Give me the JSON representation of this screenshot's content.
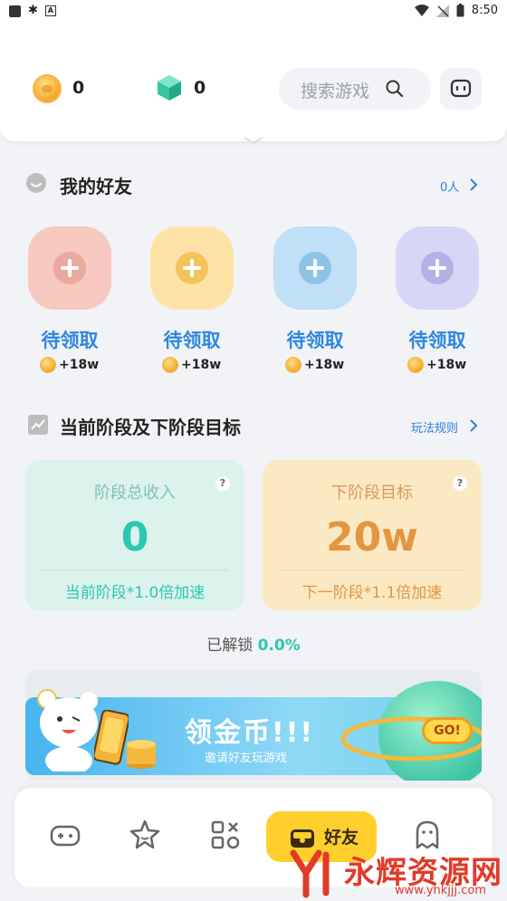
{
  "status_bar": {
    "time": "8:50"
  },
  "header": {
    "coins": "0",
    "gems": "0",
    "search_placeholder": "搜索游戏"
  },
  "friends": {
    "title": "我的好友",
    "count_link": "0人",
    "slots": [
      {
        "label": "待领取",
        "reward": "+18w",
        "color": "#f7c9c0"
      },
      {
        "label": "待领取",
        "reward": "+18w",
        "color": "#fde3a6"
      },
      {
        "label": "待领取",
        "reward": "+18w",
        "color": "#bfe0f6"
      },
      {
        "label": "待领取",
        "reward": "+18w",
        "color": "#d8d6f6"
      }
    ]
  },
  "stage": {
    "title": "当前阶段及下阶段目标",
    "rules_link": "玩法规则",
    "current": {
      "title": "阶段总收入",
      "value": "0",
      "footer": "当前阶段*1.0倍加速",
      "help": "?"
    },
    "next": {
      "title": "下阶段目标",
      "value": "20w",
      "footer": "下一阶段*1.1倍加速",
      "help": "?"
    },
    "unlock_label": "已解锁",
    "unlock_value": "0.0%"
  },
  "banner": {
    "title": "领金币!!!",
    "subtitle": "邀请好友玩游戏",
    "button": "GO!"
  },
  "bottom_nav": {
    "active_label": "好友"
  },
  "watermark": {
    "text": "永辉资源网",
    "url": "www.yhkjjj.com"
  }
}
